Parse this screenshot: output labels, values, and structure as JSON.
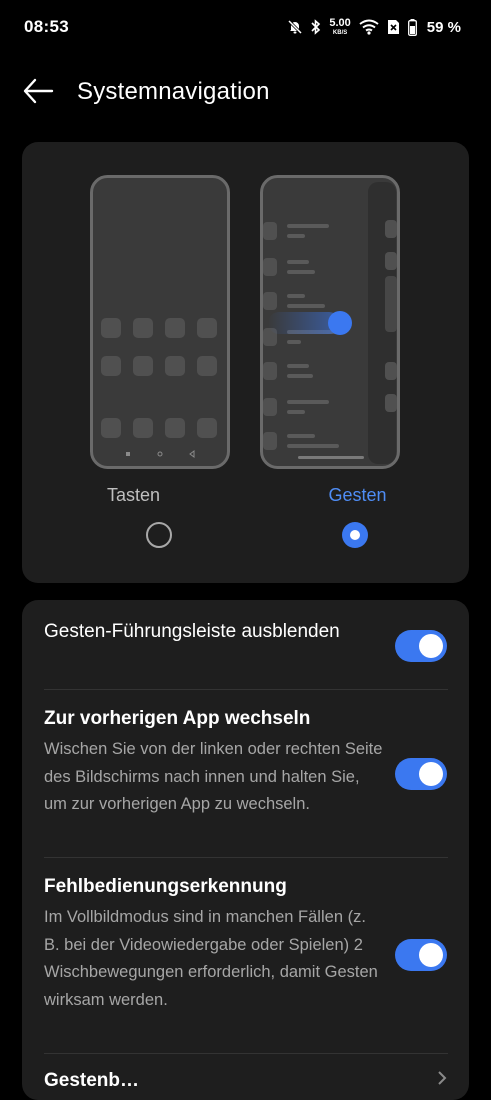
{
  "status_bar": {
    "time": "08:53",
    "net_speed_value": "5.00",
    "net_speed_unit": "KB/S",
    "battery_percent": "59 %",
    "icons": [
      "mute-bell-icon",
      "bluetooth-icon",
      "wifi-icon",
      "sim-x-icon",
      "battery-icon"
    ]
  },
  "header": {
    "title": "Systemnavigation",
    "back_icon": "arrow-left-icon"
  },
  "navigation_modes": {
    "options": [
      {
        "label": "Tasten",
        "selected": false
      },
      {
        "label": "Gesten",
        "selected": true
      }
    ]
  },
  "settings": {
    "items": [
      {
        "title": "Gesten-Führungsleiste ausblenden",
        "description": "",
        "enabled": true
      },
      {
        "title": "Zur vorherigen App wechseln",
        "description": "Wischen Sie von der linken oder rechten Seite des Bildschirms nach innen und halten Sie, um zur vorherigen App zu wechseln.",
        "enabled": true
      },
      {
        "title": "Fehlbedienungserkennung",
        "description": "Im Vollbildmodus sind in manchen Fällen (z. B. bei der Videowiedergabe oder Spielen) 2 Wischbewegungen erforderlich, damit Gesten wirksam werden.",
        "enabled": true
      },
      {
        "title": "Gestenb…",
        "description": ""
      }
    ]
  },
  "colors": {
    "accent": "#3b78f0",
    "accent_text": "#4f8df5",
    "card_bg": "#1e1e1e",
    "background": "#000000"
  }
}
